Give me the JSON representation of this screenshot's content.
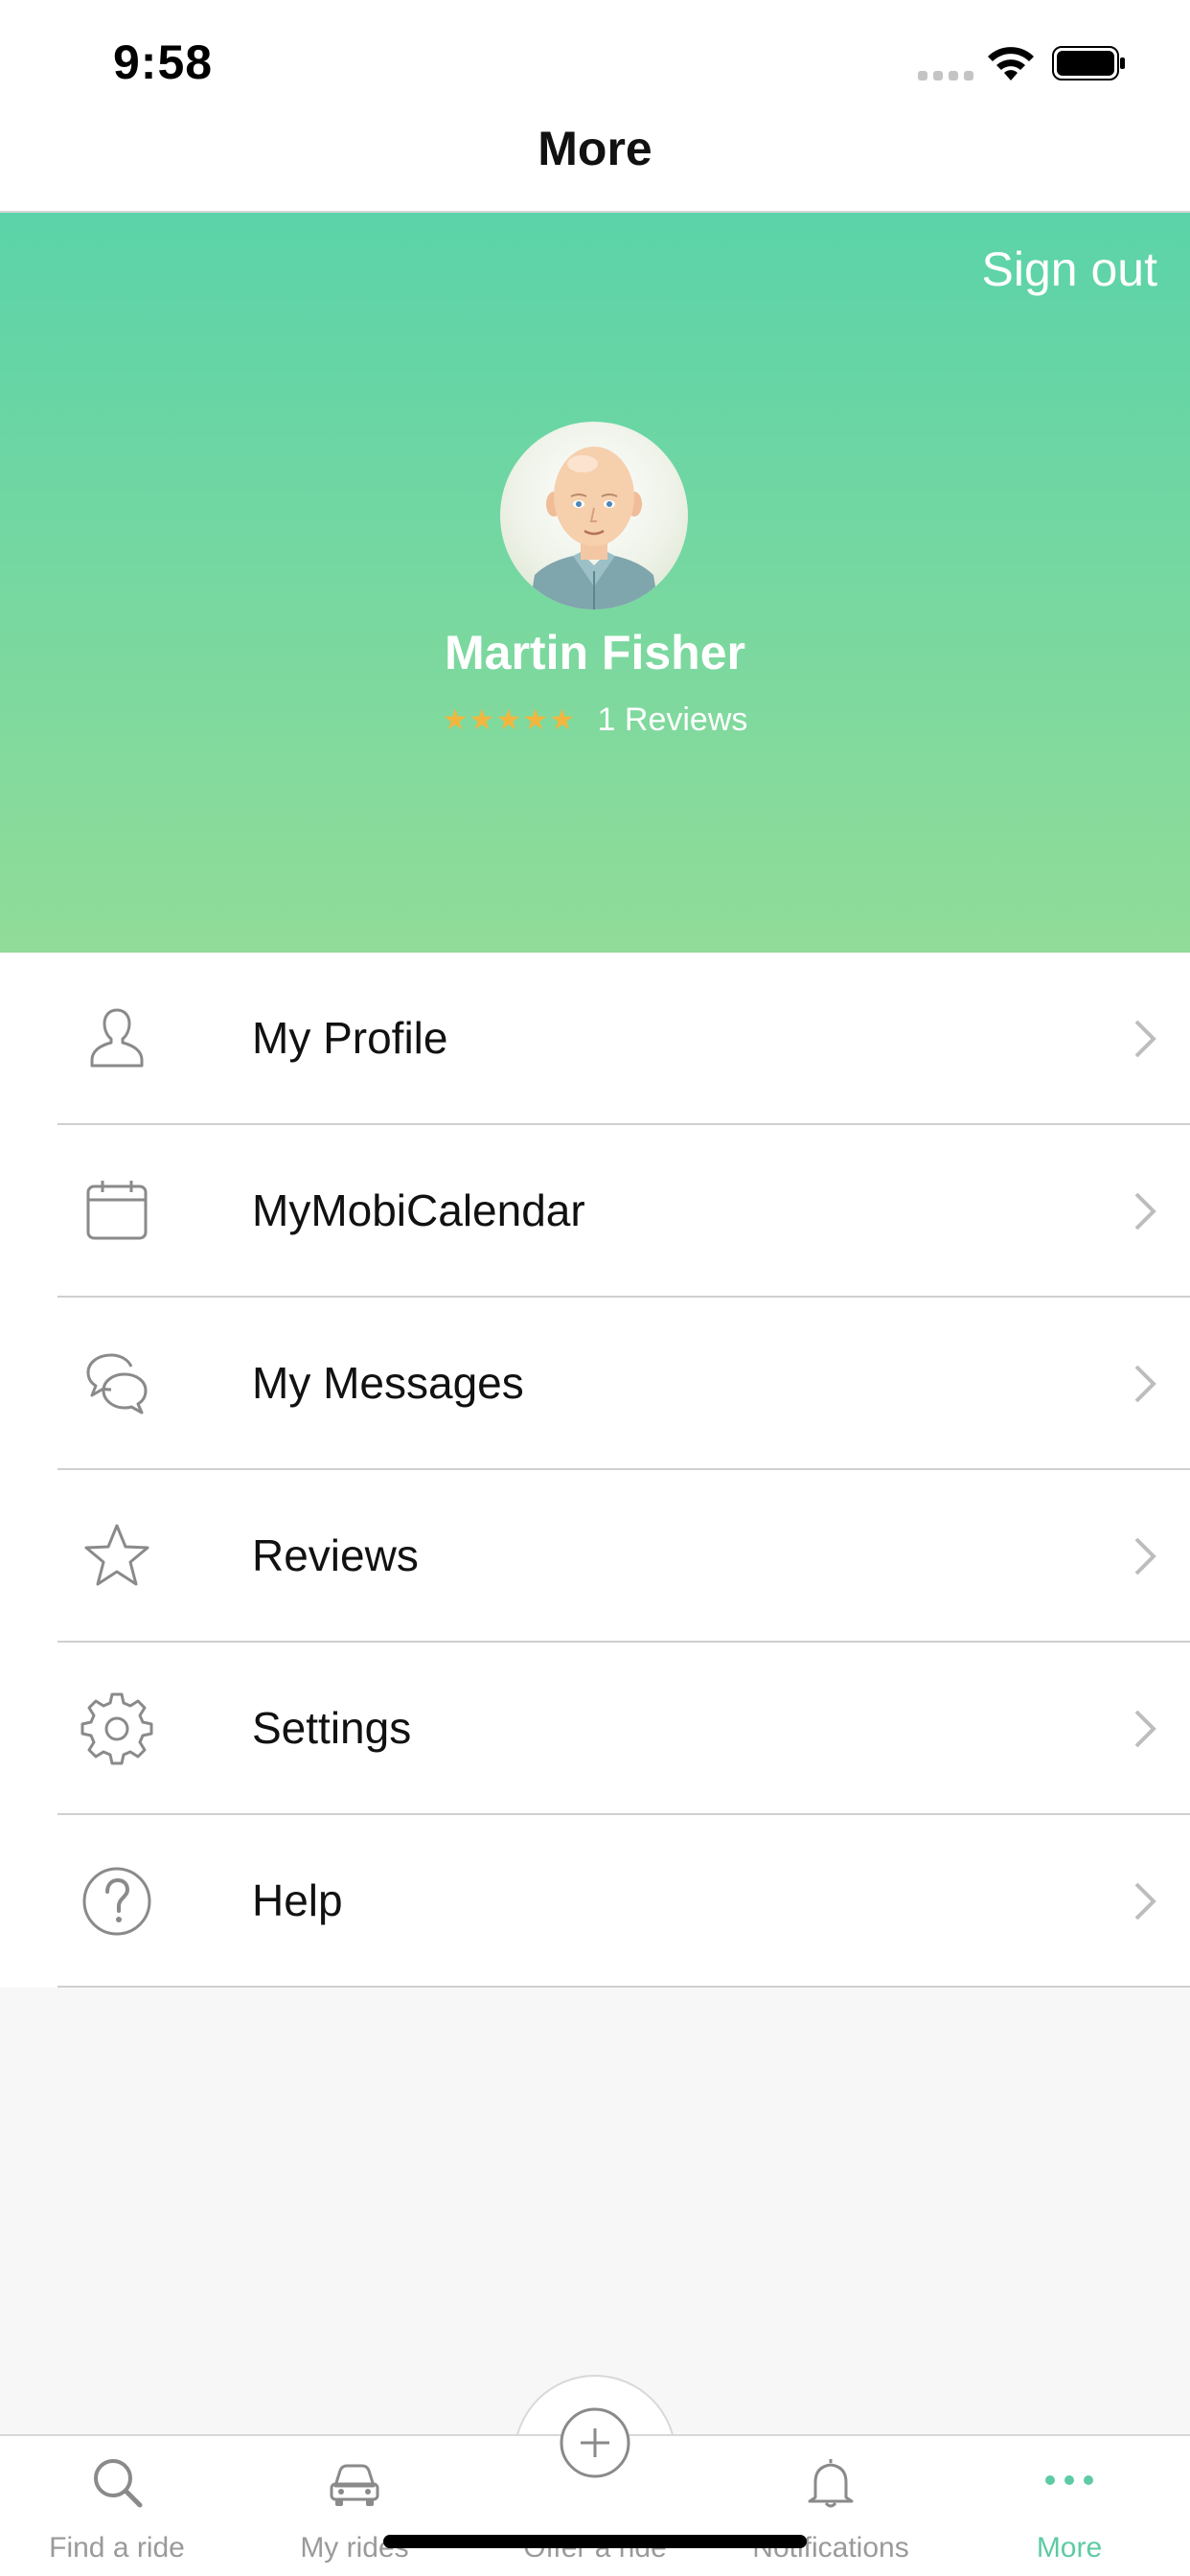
{
  "status_bar": {
    "time": "9:58"
  },
  "nav": {
    "title": "More"
  },
  "header": {
    "sign_out_label": "Sign out",
    "user_name": "Martin Fisher",
    "rating_stars": 5,
    "reviews_text": "1 Reviews",
    "gradient_top": "#5bd3a9",
    "gradient_bottom": "#91dc98",
    "star_color": "#f2b640"
  },
  "menu": {
    "items": [
      {
        "label": "My Profile",
        "icon": "person-icon"
      },
      {
        "label": "MyMobiCalendar",
        "icon": "calendar-icon"
      },
      {
        "label": "My Messages",
        "icon": "chat-bubbles-icon"
      },
      {
        "label": "Reviews",
        "icon": "star-icon"
      },
      {
        "label": "Settings",
        "icon": "gear-icon"
      },
      {
        "label": "Help",
        "icon": "question-circle-icon"
      }
    ]
  },
  "tab_bar": {
    "tabs": [
      {
        "label": "Find a ride",
        "icon": "search-icon",
        "active": false
      },
      {
        "label": "My rides",
        "icon": "car-icon",
        "active": false
      },
      {
        "label": "Offer a ride",
        "icon": "plus-circle-icon",
        "active": false
      },
      {
        "label": "Notifications",
        "icon": "bell-icon",
        "active": false
      },
      {
        "label": "More",
        "icon": "more-dots-icon",
        "active": true
      }
    ],
    "active_color": "#5ecba3"
  }
}
